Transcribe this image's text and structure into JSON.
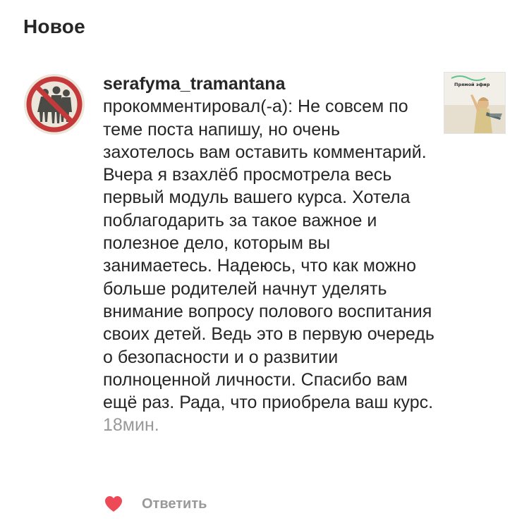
{
  "header": {
    "title": "Новое"
  },
  "notification": {
    "username": "serafyma_tramantana",
    "action": "прокомментировал(-а):",
    "comment": "Не совсем по теме поста напишу, но очень захотелось вам оставить комментарий. Вчера я взахлёб просмотрела весь первый модуль вашего курса. Хотела поблагодарить за такое важное и полезное дело, которым вы занимаетесь. Надеюсь, что как можно больше родителей начнут уделять внимание вопросу полового воспитания своих детей. Ведь это в первую очередь о безопасности и о развитии полноценной личности. Спасибо вам ещё раз. Рада, что приобрела ваш курс.",
    "time": "18мин.",
    "post_thumbnail_caption": "Прямой эфир",
    "like_icon": "heart-icon",
    "like_color": "#ed4956",
    "reply_label": "Ответить"
  },
  "colors": {
    "text": "#262626",
    "muted": "#999999",
    "avatar_ring": "#c43a3a"
  }
}
